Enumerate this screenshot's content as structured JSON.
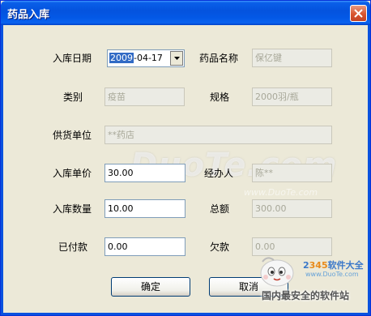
{
  "window": {
    "title": "药品入库"
  },
  "form": {
    "date": {
      "label": "入库日期",
      "value_selected": "2009",
      "value_rest": "-04-17"
    },
    "drug_name": {
      "label": "药品名称",
      "value": "保亿键"
    },
    "category": {
      "label": "类别",
      "value": "疫苗"
    },
    "spec": {
      "label": "规格",
      "value": "2000羽/瓶"
    },
    "supplier": {
      "label": "供货单位",
      "value": "**药店"
    },
    "unit_price": {
      "label": "入库单价",
      "value": "30.00"
    },
    "handler": {
      "label": "经办人",
      "value": "陈**"
    },
    "quantity": {
      "label": "入库数量",
      "value": "10.00"
    },
    "total": {
      "label": "总额",
      "value": "300.00"
    },
    "paid": {
      "label": "已付款",
      "value": "0.00"
    },
    "owed": {
      "label": "欠款",
      "value": "0.00"
    }
  },
  "buttons": {
    "ok": "确定",
    "cancel": "取消"
  },
  "watermark": {
    "main": "DuoTe.com",
    "url": "www.DuoTe.com",
    "brand_prefix": "2",
    "brand_num": "345",
    "brand_suffix": "软件大全",
    "brand_small": "www.DuoTe.com",
    "tagline": "国内最安全的软件站"
  },
  "colors": {
    "titlebar": "#0453de",
    "dialog_bg": "#ece9d8",
    "selection": "#316ac5",
    "close_button": "#d9552e"
  }
}
